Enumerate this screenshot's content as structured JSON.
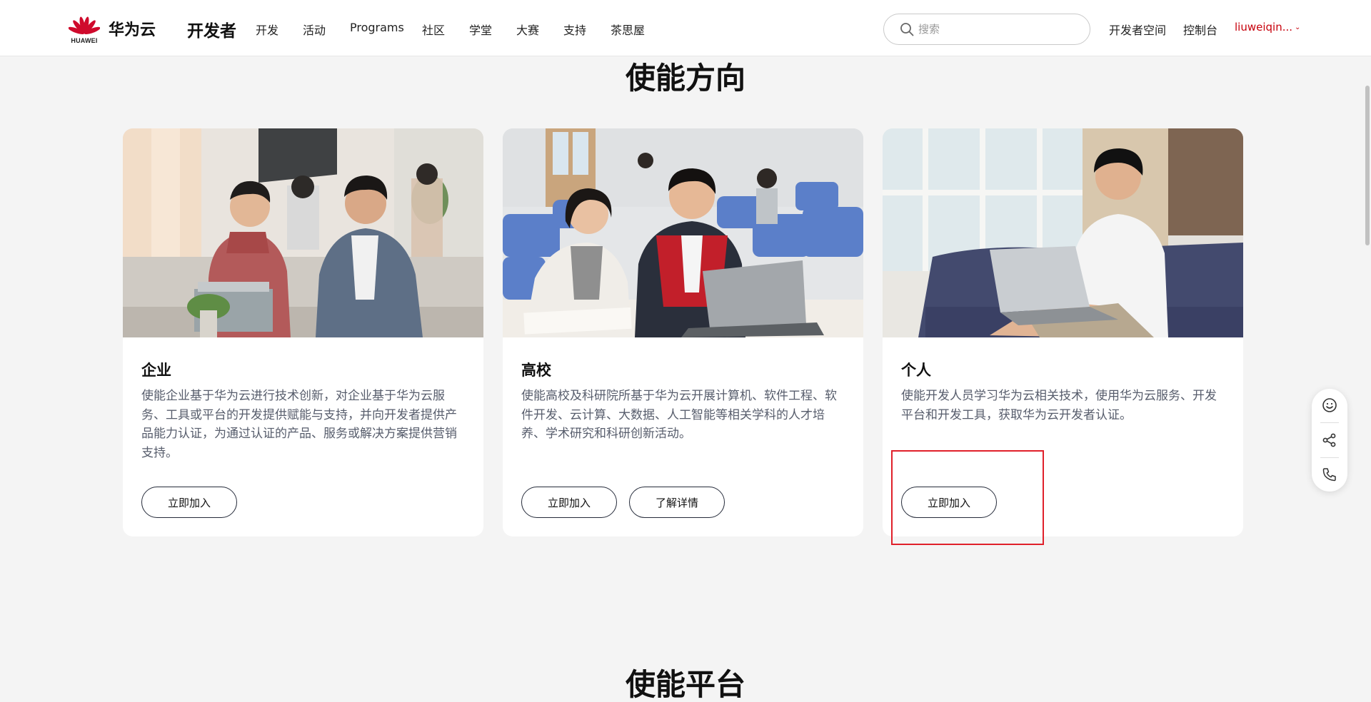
{
  "header": {
    "brand": "华为云",
    "logo_caption": "HUAWEI",
    "dev_title": "开发者",
    "nav": [
      "开发",
      "活动",
      "Programs",
      "社区",
      "学堂",
      "大赛",
      "支持",
      "茶思屋"
    ],
    "search_placeholder": "搜索",
    "links": [
      "开发者空间",
      "控制台"
    ],
    "user": "liuweiqin...",
    "brand_color": "#c7000b"
  },
  "sections": {
    "direction_title": "使能方向",
    "platform_title": "使能平台"
  },
  "cards": [
    {
      "title": "企业",
      "desc": "使能企业基于华为云进行技术创新，对企业基于华为云服务、工具或平台的开发提供赋能与支持，并向开发者提供产品能力认证，为通过认证的产品、服务或解决方案提供营销支持。",
      "buttons": [
        "立即加入"
      ]
    },
    {
      "title": "高校",
      "desc": "使能高校及科研院所基于华为云开展计算机、软件工程、软件开发、云计算、大数据、人工智能等相关学科的人才培养、学术研究和科研创新活动。",
      "buttons": [
        "立即加入",
        "了解详情"
      ]
    },
    {
      "title": "个人",
      "desc": "使能开发人员学习华为云相关技术，使用华为云服务、开发平台和开发工具，获取华为云开发者认证。",
      "buttons": [
        "立即加入"
      ]
    }
  ],
  "float_toolbar": {
    "icons": [
      "smile-icon",
      "share-icon",
      "phone-icon"
    ]
  }
}
